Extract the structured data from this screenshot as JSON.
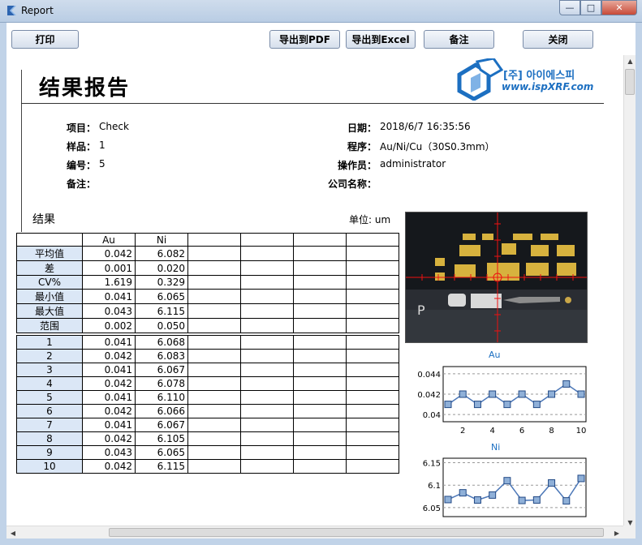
{
  "window": {
    "title": "Report",
    "min_symbol": "—",
    "max_symbol": "□",
    "close_symbol": "✕"
  },
  "toolbar": {
    "print": "打印",
    "export_pdf": "导出到PDF",
    "export_excel": "导出到Excel",
    "notes": "备注",
    "close": "关闭"
  },
  "report": {
    "title": "结果报告",
    "brand_line1": "[주] 아이에스피",
    "brand_line2": "www.ispXRF.com",
    "left_info": [
      {
        "label": "项目：",
        "value": "Check"
      },
      {
        "label": "样品：",
        "value": "1"
      },
      {
        "label": "编号：",
        "value": "5"
      },
      {
        "label": "备注：",
        "value": ""
      }
    ],
    "right_info": [
      {
        "label": "日期：",
        "value": "2018/6/7 16:35:56"
      },
      {
        "label": "程序：",
        "value": "Au/Ni/Cu（30S0.3mm）"
      },
      {
        "label": "操作员：",
        "value": "administrator"
      },
      {
        "label": "公司名称：",
        "value": ""
      }
    ],
    "results_title": "结果",
    "unit_label": "单位: um"
  },
  "stats_table": {
    "headers": [
      "",
      "Au",
      "Ni",
      "",
      "",
      "",
      ""
    ],
    "rows": [
      {
        "label": "平均值",
        "au": "0.042",
        "ni": "6.082"
      },
      {
        "label": "差",
        "au": "0.001",
        "ni": "0.020"
      },
      {
        "label": "CV%",
        "au": "1.619",
        "ni": "0.329"
      },
      {
        "label": "最小值",
        "au": "0.041",
        "ni": "6.065"
      },
      {
        "label": "最大值",
        "au": "0.043",
        "ni": "6.115"
      },
      {
        "label": "范围",
        "au": "0.002",
        "ni": "0.050"
      }
    ]
  },
  "measure_table": {
    "rows": [
      {
        "label": "1",
        "au": "0.041",
        "ni": "6.068"
      },
      {
        "label": "2",
        "au": "0.042",
        "ni": "6.083"
      },
      {
        "label": "3",
        "au": "0.041",
        "ni": "6.067"
      },
      {
        "label": "4",
        "au": "0.042",
        "ni": "6.078"
      },
      {
        "label": "5",
        "au": "0.041",
        "ni": "6.110"
      },
      {
        "label": "6",
        "au": "0.042",
        "ni": "6.066"
      },
      {
        "label": "7",
        "au": "0.041",
        "ni": "6.067"
      },
      {
        "label": "8",
        "au": "0.042",
        "ni": "6.105"
      },
      {
        "label": "9",
        "au": "0.043",
        "ni": "6.065"
      },
      {
        "label": "10",
        "au": "0.042",
        "ni": "6.115"
      }
    ]
  },
  "chart_data": [
    {
      "type": "line",
      "title": "Au",
      "x": [
        1,
        2,
        3,
        4,
        5,
        6,
        7,
        8,
        9,
        10
      ],
      "values": [
        0.041,
        0.042,
        0.041,
        0.042,
        0.041,
        0.042,
        0.041,
        0.042,
        0.043,
        0.042
      ],
      "xticks": [
        2,
        4,
        6,
        8,
        10
      ],
      "yticks": [
        0.044,
        0.042,
        0.04
      ],
      "ylim": [
        0.0393,
        0.0447
      ],
      "grid": true,
      "color": "#4d78b8"
    },
    {
      "type": "line",
      "title": "Ni",
      "x": [
        1,
        2,
        3,
        4,
        5,
        6,
        7,
        8,
        9,
        10
      ],
      "values": [
        6.068,
        6.083,
        6.067,
        6.078,
        6.11,
        6.066,
        6.067,
        6.105,
        6.065,
        6.115
      ],
      "yticks": [
        6.15,
        6.1,
        6.05
      ],
      "ylim": [
        6.03,
        6.16
      ],
      "grid": true,
      "color": "#4d78b8"
    }
  ]
}
